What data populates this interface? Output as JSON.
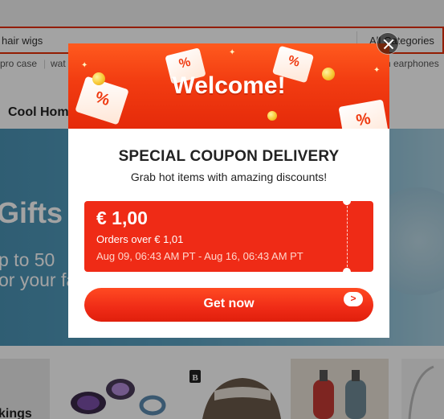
{
  "search": {
    "value": "hair wigs",
    "category_label": "All Categories"
  },
  "hotwords": [
    "pro case",
    "wat",
    "h earphones"
  ],
  "section": {
    "title": "Cool Hom"
  },
  "banner": {
    "headline": "Gifts f",
    "line1": "p to 50",
    "line2": "or your fa"
  },
  "products": {
    "first_label": "kings"
  },
  "modal": {
    "welcome": "Welcome!",
    "ticket_text": "%",
    "title": "SPECIAL COUPON DELIVERY",
    "subtitle": "Grab hot items with amazing discounts!",
    "coupon": {
      "amount": "€ 1,00",
      "min_order": "Orders over € 1,01",
      "validity": "Aug 09, 06:43 AM PT - Aug 16, 06:43 AM PT"
    },
    "cta_label": "Get now",
    "cta_arrow": ">"
  },
  "colors": {
    "brand_red": "#ef2b16",
    "header_orange": "#f23c11",
    "banner_blue": "#5aa2c2"
  },
  "icons": {
    "close": "close-icon",
    "arrow": "chevron-right-icon"
  }
}
